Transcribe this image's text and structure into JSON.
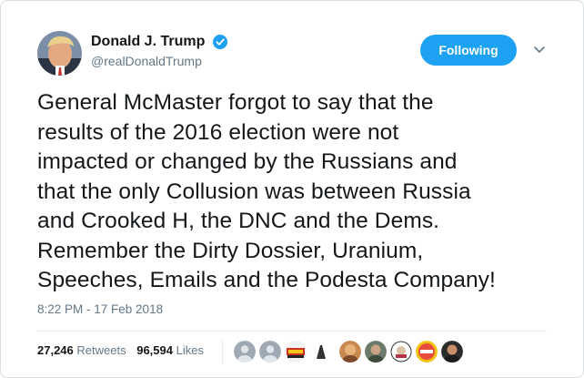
{
  "author": {
    "display_name": "Donald J. Trump",
    "handle": "@realDonaldTrump",
    "verified": true
  },
  "actions": {
    "follow_label": "Following",
    "menu_icon": "chevron-down-icon"
  },
  "tweet": {
    "lines": [
      "General McMaster forgot to say that the",
      "results of the 2016 election were not",
      "impacted or changed by the Russians and",
      "that the only Collusion was between Russia",
      "and Crooked H, the DNC and the Dems.",
      "Remember the Dirty Dossier, Uranium,",
      "Speeches, Emails and the Podesta Company!"
    ],
    "timestamp": "8:22 PM - 17 Feb 2018"
  },
  "stats": {
    "retweets_count": "27,246",
    "retweets_label": "Retweets",
    "likes_count": "96,594",
    "likes_label": "Likes"
  },
  "colors": {
    "accent": "#1da1f2",
    "text": "#14171a",
    "muted": "#657786",
    "divider": "#e6ecf0"
  }
}
